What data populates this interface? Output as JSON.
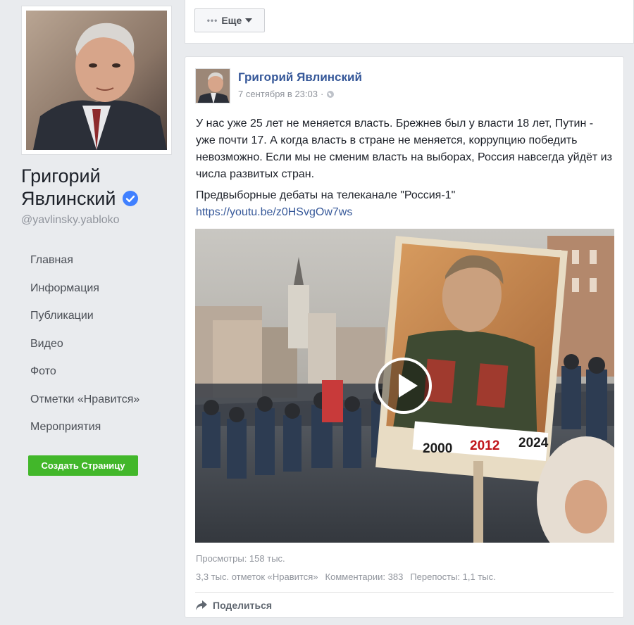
{
  "profile": {
    "name": "Григорий Явлинский",
    "handle": "@yavlinsky.yabloko",
    "verified_color": "#4080ff"
  },
  "nav": {
    "items": [
      {
        "label": "Главная"
      },
      {
        "label": "Информация"
      },
      {
        "label": "Публикации"
      },
      {
        "label": "Видео"
      },
      {
        "label": "Фото"
      },
      {
        "label": "Отметки «Нравится»"
      },
      {
        "label": "Мероприятия"
      }
    ]
  },
  "create_page_button": "Создать Страницу",
  "more_button": "Еще",
  "post": {
    "author": "Григорий Явлинский",
    "timestamp": "7 сентября в 23:03",
    "separator": "·",
    "text": "У нас уже 25 лет не меняется власть. Брежнев был у власти 18 лет, Путин - уже почти 17. А когда власть в стране не меняется, коррупцию победить невозможно. Если мы не сменим власть на выборах, Россия навсегда уйдёт из числа развитых стран.",
    "text2": "Предвыборные дебаты на телеканале \"Россия-1\"",
    "link": "https://youtu.be/z0HSvgOw7ws",
    "video_poster_years": [
      "2000",
      "2012",
      "2024"
    ],
    "views": "Просмотры: 158 тыс.",
    "likes": "3,3 тыс. отметок «Нравится»",
    "comments": "Комментарии: 383",
    "shares": "Перепосты: 1,1 тыс.",
    "share_label": "Поделиться"
  },
  "colors": {
    "link": "#365899",
    "accent_green": "#42b72a",
    "year_highlight": "#c0151b"
  }
}
